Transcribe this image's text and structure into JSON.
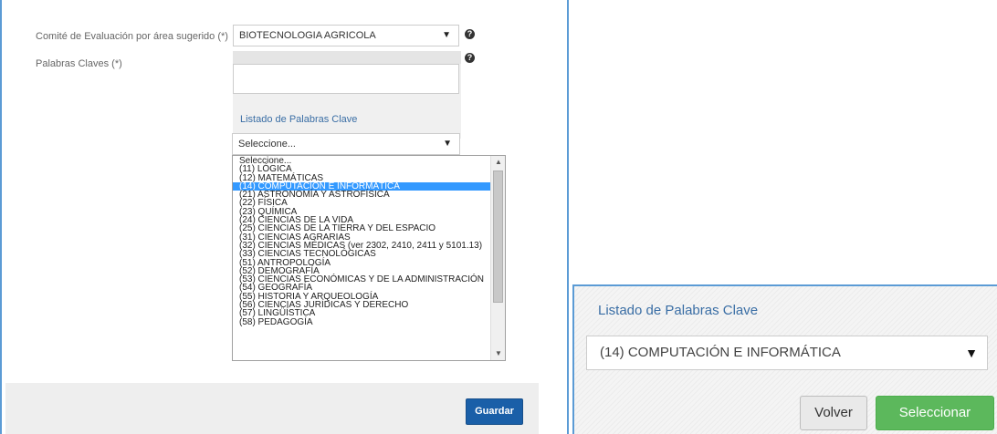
{
  "form": {
    "comite_label": "Comité de Evaluación por área sugerido (*)",
    "comite_value": "BIOTECNOLOGIA AGRICOLA",
    "palabras_label": "Palabras Claves (*)",
    "listado_label": "Listado de Palabras Clave",
    "dropdown_value": "Seleccione..."
  },
  "listbox": {
    "selected_index": 3,
    "options": [
      "Seleccione...",
      "(11) LÓGICA",
      "(12) MATEMÁTICAS",
      "(14) COMPUTACIÓN E INFORMÁTICA",
      "(21) ASTRONOMÍA Y ASTROFÍSICA",
      "(22) FÍSICA",
      "(23) QUÍMICA",
      "(24) CIENCIAS DE LA VIDA",
      "(25) CIENCIAS DE LA TIERRA Y DEL ESPACIO",
      "(31) CIENCIAS AGRARIAS",
      "(32) CIENCIAS MÉDICAS (ver 2302, 2410, 2411 y 5101.13)",
      "(33) CIENCIAS TECNOLÓGICAS",
      "(51) ANTROPOLOGÍA",
      "(52) DEMOGRAFÍA",
      "(53) CIENCIAS ECONÓMICAS Y DE LA ADMINISTRACIÓN",
      "(54) GEOGRAFÍA",
      "(55) HISTORIA Y ARQUEOLOGÍA",
      "(56) CIENCIAS JURÍDICAS Y DERECHO",
      "(57) LINGÜÍSTICA",
      "(58) PEDAGOGÍA"
    ]
  },
  "buttons": {
    "guardar": "Guardar",
    "volver": "Volver",
    "seleccionar": "Seleccionar"
  },
  "zoom_panel": {
    "title": "Listado de Palabras Clave",
    "select_value": "(14) COMPUTACIÓN E INFORMÁTICA"
  },
  "icons": {
    "help": "?",
    "caret": "▼",
    "scroll_up": "▲",
    "scroll_down": "▼"
  },
  "colors": {
    "accent_blue": "#1a5fa8",
    "selection_blue": "#3399ff",
    "success_green": "#5cb85c",
    "link_blue": "#3a6ea5"
  }
}
